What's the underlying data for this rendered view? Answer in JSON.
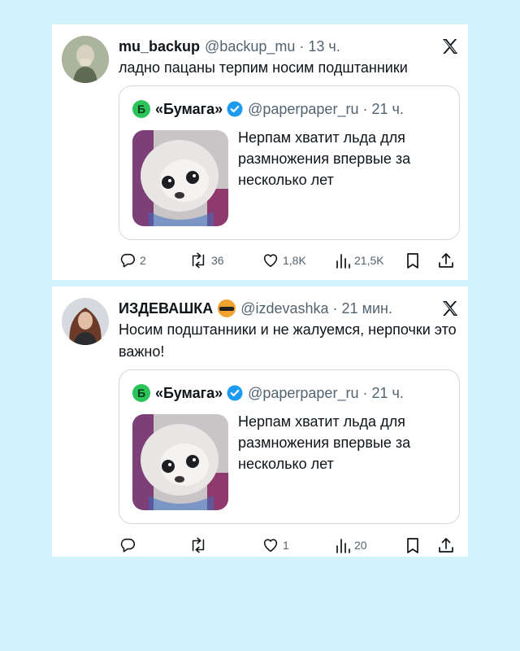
{
  "tweets": [
    {
      "author_name": "mu_backup",
      "handle_time": "@backup_mu · 13 ч.",
      "text": "ладно пацаны терпим носим подштанники",
      "quote": {
        "logo_letter": "Б",
        "name": "«Бумага»",
        "handle_time": "@paperpaper_ru · 21 ч.",
        "text": "Нерпам хватит льда для размножения впервые за несколько лет"
      },
      "stats": {
        "replies": "2",
        "reposts": "36",
        "likes": "1,8K",
        "views": "21,5K"
      }
    },
    {
      "author_name": "ИЗДЕВАШКА",
      "handle_time": "@izdevashka · 21 мин.",
      "text": "Носим подштанники и не жалуемся, нерпочки это важно!",
      "quote": {
        "logo_letter": "Б",
        "name": "«Бумага»",
        "handle_time": "@paperpaper_ru · 21 ч.",
        "text": "Нерпам хватит льда для размножения впервые за несколько лет"
      },
      "stats": {
        "replies": "",
        "reposts": "",
        "likes": "1",
        "views": "20"
      }
    }
  ],
  "icons": {
    "platform": "x-logo-icon",
    "verified": "verified-badge-icon",
    "reply": "reply-icon",
    "repost": "repost-icon",
    "like": "heart-icon",
    "views": "views-icon",
    "bookmark": "bookmark-icon",
    "share": "share-icon",
    "emoji": "angry-censored-face-emoji"
  },
  "colors": {
    "page_background": "#d2f3fb",
    "verified_blue": "#1d9bf0",
    "muted_text": "#536471",
    "quote_logo_green": "#2bc45a"
  }
}
